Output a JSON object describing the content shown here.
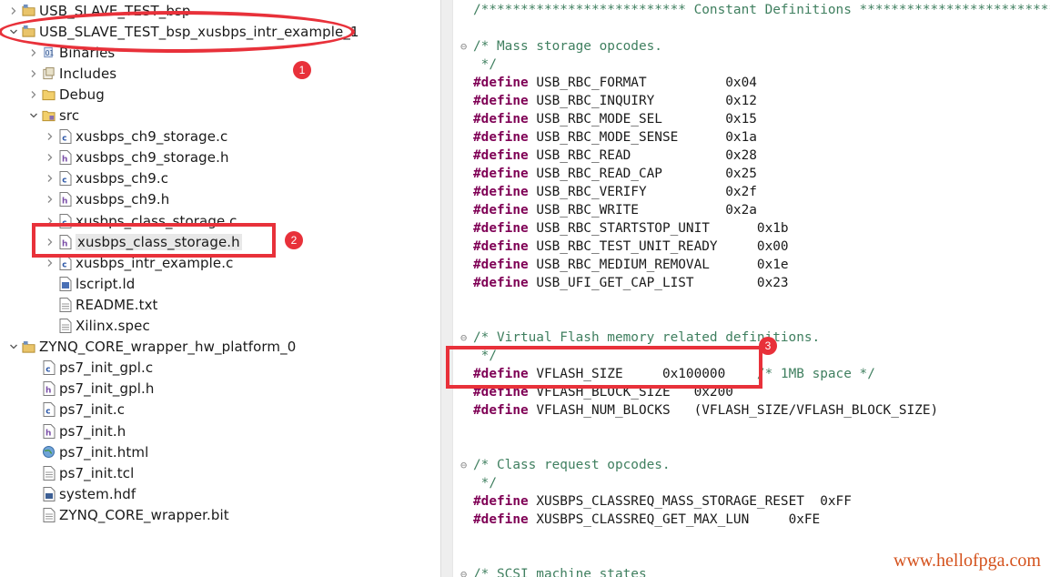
{
  "project_tree": {
    "items": [
      {
        "label": "USB_SLAVE_TEST_bsp",
        "icon": "project-folder-icon",
        "expanded": false,
        "level": 0
      },
      {
        "label": "USB_SLAVE_TEST_bsp_xusbps_intr_example_1",
        "icon": "project-folder-icon",
        "expanded": true,
        "level": 0
      },
      {
        "label": "Binaries",
        "icon": "binaries-icon",
        "expanded": false,
        "level": 1
      },
      {
        "label": "Includes",
        "icon": "includes-icon",
        "expanded": false,
        "level": 1
      },
      {
        "label": "Debug",
        "icon": "folder-icon",
        "expanded": false,
        "level": 1
      },
      {
        "label": "src",
        "icon": "source-folder-icon",
        "expanded": true,
        "level": 1
      },
      {
        "label": "xusbps_ch9_storage.c",
        "icon": "c-file-icon",
        "expanded": false,
        "level": 2
      },
      {
        "label": "xusbps_ch9_storage.h",
        "icon": "h-file-icon",
        "expanded": false,
        "level": 2
      },
      {
        "label": "xusbps_ch9.c",
        "icon": "c-file-icon",
        "expanded": false,
        "level": 2
      },
      {
        "label": "xusbps_ch9.h",
        "icon": "h-file-icon",
        "expanded": false,
        "level": 2
      },
      {
        "label": "xusbps_class_storage.c",
        "icon": "c-file-icon",
        "expanded": false,
        "level": 2
      },
      {
        "label": "xusbps_class_storage.h",
        "icon": "h-file-icon",
        "expanded": false,
        "level": 2,
        "selected": true
      },
      {
        "label": "xusbps_intr_example.c",
        "icon": "c-file-icon",
        "expanded": false,
        "level": 2
      },
      {
        "label": "lscript.ld",
        "icon": "linker-script-icon",
        "level": 2
      },
      {
        "label": "README.txt",
        "icon": "text-file-icon",
        "level": 2
      },
      {
        "label": "Xilinx.spec",
        "icon": "text-file-icon",
        "level": 2
      },
      {
        "label": "ZYNQ_CORE_wrapper_hw_platform_0",
        "icon": "project-folder-icon",
        "expanded": true,
        "level": 0
      },
      {
        "label": "ps7_init_gpl.c",
        "icon": "c-file-icon",
        "level": 1
      },
      {
        "label": "ps7_init_gpl.h",
        "icon": "h-file-icon",
        "level": 1
      },
      {
        "label": "ps7_init.c",
        "icon": "c-file-icon",
        "level": 1
      },
      {
        "label": "ps7_init.h",
        "icon": "h-file-icon",
        "level": 1
      },
      {
        "label": "ps7_init.html",
        "icon": "globe-icon",
        "level": 1
      },
      {
        "label": "ps7_init.tcl",
        "icon": "text-file-icon",
        "level": 1
      },
      {
        "label": "system.hdf",
        "icon": "hdf-file-icon",
        "level": 1
      },
      {
        "label": "ZYNQ_CORE_wrapper.bit",
        "icon": "text-file-icon",
        "level": 1
      }
    ]
  },
  "editor": {
    "lines": [
      {
        "fold": "",
        "parts": [
          {
            "t": "/************************** Constant Definitions *****************************",
            "c": "cm"
          }
        ]
      },
      {
        "fold": "",
        "parts": []
      },
      {
        "fold": "⊖",
        "parts": [
          {
            "t": "/* Mass storage opcodes.",
            "c": "cm"
          }
        ]
      },
      {
        "fold": "",
        "parts": [
          {
            "t": " */",
            "c": "cm"
          }
        ]
      },
      {
        "fold": "",
        "parts": [
          {
            "t": "#define",
            "c": "kw"
          },
          {
            "t": " USB_RBC_FORMAT          0x04",
            "c": "nm"
          }
        ]
      },
      {
        "fold": "",
        "parts": [
          {
            "t": "#define",
            "c": "kw"
          },
          {
            "t": " USB_RBC_INQUIRY         0x12",
            "c": "nm"
          }
        ]
      },
      {
        "fold": "",
        "parts": [
          {
            "t": "#define",
            "c": "kw"
          },
          {
            "t": " USB_RBC_MODE_SEL        0x15",
            "c": "nm"
          }
        ]
      },
      {
        "fold": "",
        "parts": [
          {
            "t": "#define",
            "c": "kw"
          },
          {
            "t": " USB_RBC_MODE_SENSE      0x1a",
            "c": "nm"
          }
        ]
      },
      {
        "fold": "",
        "parts": [
          {
            "t": "#define",
            "c": "kw"
          },
          {
            "t": " USB_RBC_READ            0x28",
            "c": "nm"
          }
        ]
      },
      {
        "fold": "",
        "parts": [
          {
            "t": "#define",
            "c": "kw"
          },
          {
            "t": " USB_RBC_READ_CAP        0x25",
            "c": "nm"
          }
        ]
      },
      {
        "fold": "",
        "parts": [
          {
            "t": "#define",
            "c": "kw"
          },
          {
            "t": " USB_RBC_VERIFY          0x2f",
            "c": "nm"
          }
        ]
      },
      {
        "fold": "",
        "parts": [
          {
            "t": "#define",
            "c": "kw"
          },
          {
            "t": " USB_RBC_WRITE           0x2a",
            "c": "nm"
          }
        ]
      },
      {
        "fold": "",
        "parts": [
          {
            "t": "#define",
            "c": "kw"
          },
          {
            "t": " USB_RBC_STARTSTOP_UNIT      0x1b",
            "c": "nm"
          }
        ]
      },
      {
        "fold": "",
        "parts": [
          {
            "t": "#define",
            "c": "kw"
          },
          {
            "t": " USB_RBC_TEST_UNIT_READY     0x00",
            "c": "nm"
          }
        ]
      },
      {
        "fold": "",
        "parts": [
          {
            "t": "#define",
            "c": "kw"
          },
          {
            "t": " USB_RBC_MEDIUM_REMOVAL      0x1e",
            "c": "nm"
          }
        ]
      },
      {
        "fold": "",
        "parts": [
          {
            "t": "#define",
            "c": "kw"
          },
          {
            "t": " USB_UFI_GET_CAP_LIST        0x23",
            "c": "nm"
          }
        ]
      },
      {
        "fold": "",
        "parts": []
      },
      {
        "fold": "",
        "parts": []
      },
      {
        "fold": "⊖",
        "parts": [
          {
            "t": "/* Virtual Flash memory related definitions.",
            "c": "cm"
          }
        ]
      },
      {
        "fold": "",
        "parts": [
          {
            "t": " */",
            "c": "cm"
          }
        ]
      },
      {
        "fold": "",
        "parts": [
          {
            "t": "#define",
            "c": "kw"
          },
          {
            "t": " VFLASH_SIZE     0x100000    ",
            "c": "nm"
          },
          {
            "t": "/* 1MB space */",
            "c": "cm"
          }
        ]
      },
      {
        "fold": "",
        "parts": [
          {
            "t": "#define",
            "c": "kw"
          },
          {
            "t": " VFLASH_BLOCK_SIZE   0x200",
            "c": "nm"
          }
        ]
      },
      {
        "fold": "",
        "parts": [
          {
            "t": "#define",
            "c": "kw"
          },
          {
            "t": " VFLASH_NUM_BLOCKS   (VFLASH_SIZE/VFLASH_BLOCK_SIZE)",
            "c": "nm"
          }
        ]
      },
      {
        "fold": "",
        "parts": []
      },
      {
        "fold": "",
        "parts": []
      },
      {
        "fold": "⊖",
        "parts": [
          {
            "t": "/* Class request opcodes.",
            "c": "cm"
          }
        ]
      },
      {
        "fold": "",
        "parts": [
          {
            "t": " */",
            "c": "cm"
          }
        ]
      },
      {
        "fold": "",
        "parts": [
          {
            "t": "#define",
            "c": "kw"
          },
          {
            "t": " XUSBPS_CLASSREQ_MASS_STORAGE_RESET  0xFF",
            "c": "nm"
          }
        ]
      },
      {
        "fold": "",
        "parts": [
          {
            "t": "#define",
            "c": "kw"
          },
          {
            "t": " XUSBPS_CLASSREQ_GET_MAX_LUN     0xFE",
            "c": "nm"
          }
        ]
      },
      {
        "fold": "",
        "parts": []
      },
      {
        "fold": "",
        "parts": []
      },
      {
        "fold": "⊖",
        "parts": [
          {
            "t": "/* SCSI machine states",
            "c": "cm"
          }
        ]
      }
    ]
  },
  "annotations": {
    "badges": [
      "1",
      "2",
      "3"
    ],
    "color": "#e8313a"
  },
  "watermark": "www.hellofpga.com"
}
